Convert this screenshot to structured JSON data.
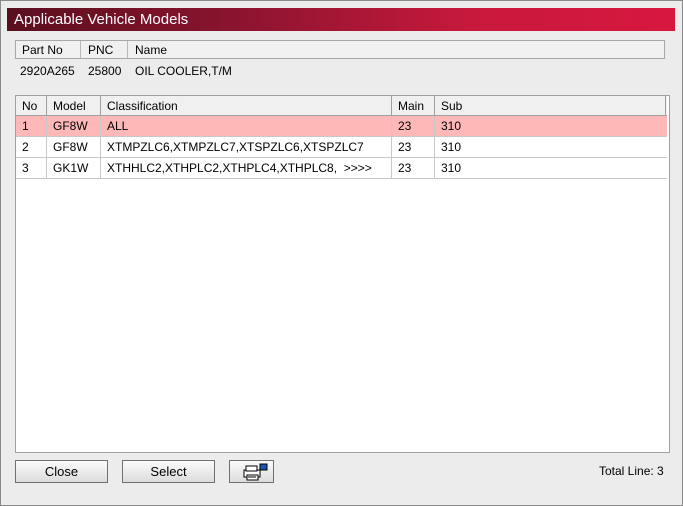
{
  "window": {
    "title": "Applicable Vehicle Models"
  },
  "part_info": {
    "headers": {
      "part_no": "Part No",
      "pnc": "PNC",
      "name": "Name"
    },
    "values": {
      "part_no": "2920A265",
      "pnc": "25800",
      "name": "OIL COOLER,T/M"
    }
  },
  "grid": {
    "headers": {
      "no": "No",
      "model": "Model",
      "classification": "Classification",
      "main": "Main",
      "sub": "Sub"
    },
    "rows": [
      {
        "no": "1",
        "model": "GF8W",
        "classification": "ALL",
        "main": "23",
        "sub": "310"
      },
      {
        "no": "2",
        "model": "GF8W",
        "classification": "XTMPZLC6,XTMPZLC7,XTSPZLC6,XTSPZLC7",
        "main": "23",
        "sub": "310"
      },
      {
        "no": "3",
        "model": "GK1W",
        "classification": "XTHHLC2,XTHPLC2,XTHPLC4,XTHPLC8,  >>>>",
        "main": "23",
        "sub": "310"
      }
    ],
    "selected_row": 1,
    "selected_color": "#ffb8b8"
  },
  "buttons": {
    "close": "Close",
    "select": "Select",
    "print_icon": "printer-icon"
  },
  "status": {
    "total_line": "Total Line: 3"
  },
  "colors": {
    "title_gradient_start": "#5a0f1e",
    "title_gradient_end": "#d8173f"
  }
}
